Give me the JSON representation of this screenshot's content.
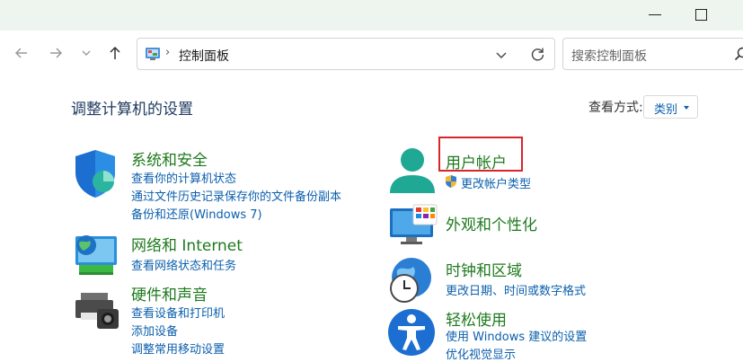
{
  "window": {
    "title_controls": [
      "minimize",
      "maximize"
    ]
  },
  "nav": {
    "back_icon": "arrow-left-icon",
    "forward_icon": "arrow-right-icon",
    "recent_icon": "chevron-down-icon",
    "up_icon": "arrow-up-icon"
  },
  "address": {
    "separator": "›",
    "path": "控制面板"
  },
  "search": {
    "placeholder": "搜索控制面板"
  },
  "page": {
    "title": "调整计算机的设置",
    "view_by_label": "查看方式:",
    "view_by_value": "类别"
  },
  "categories": [
    {
      "title": "系统和安全",
      "icon": "shield-icon",
      "links": [
        "查看你的计算机状态",
        "通过文件历史记录保存你的文件备份副本",
        "备份和还原(Windows 7)"
      ]
    },
    {
      "title": "网络和 Internet",
      "icon": "network-globe-icon",
      "links": [
        "查看网络状态和任务"
      ]
    },
    {
      "title": "硬件和声音",
      "icon": "printer-icon",
      "links": [
        "查看设备和打印机",
        "添加设备",
        "调整常用移动设置"
      ]
    },
    {
      "title": "用户帐户",
      "icon": "user-icon",
      "links": [
        "更改帐户类型"
      ]
    },
    {
      "title": "外观和个性化",
      "icon": "monitor-palette-icon",
      "links": []
    },
    {
      "title": "时钟和区域",
      "icon": "clock-globe-icon",
      "links": [
        "更改日期、时间或数字格式"
      ]
    },
    {
      "title": "轻松使用",
      "icon": "accessibility-icon",
      "links": [
        "使用 Windows 建议的设置",
        "优化视觉显示"
      ]
    }
  ],
  "colors": {
    "category_title": "#1e7a1e",
    "link": "#0b5fad",
    "highlight": "#d7262b",
    "titlebar": "#eef4ee"
  }
}
